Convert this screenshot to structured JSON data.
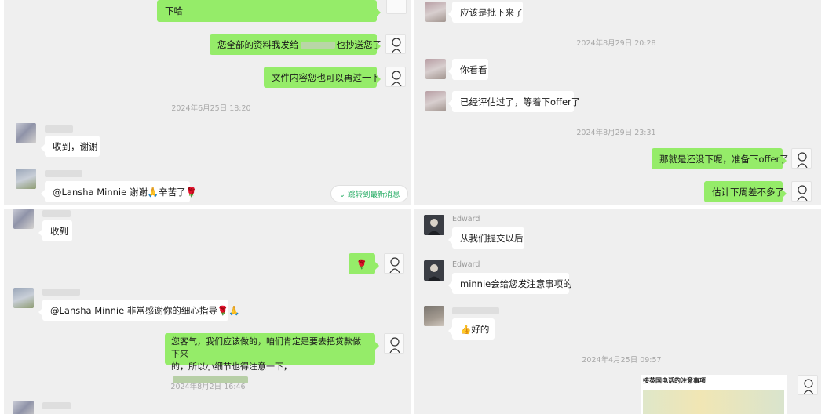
{
  "panel_tl": {
    "top_bubble": "下哈",
    "bubble_1": {
      "before": "您全部的资料我发给",
      "after": "也抄送您了"
    },
    "bubble_2": "文件内容您也可以再过一下",
    "timestamp": "2024年6月25日 18:20",
    "bubble_3": "收到，谢谢",
    "bubble_4": "@Lansha Minnie 谢谢🙏辛苦了🌹",
    "jump_button": "⌄ 跳转到最新消息"
  },
  "panel_tr": {
    "top_bubble": "应该是批下来了",
    "timestamp_1": "2024年8月29日 20:28",
    "bubble_1": "你看看",
    "bubble_2": "已经评估过了，等着下offer了",
    "timestamp_2": "2024年8月29日 23:31",
    "bubble_3": "那就是还没下呢，准备下offer了",
    "bubble_4": "估计下周差不多了"
  },
  "panel_bl": {
    "bubble_1": "收到",
    "bubble_2": "🌹",
    "bubble_3": "@Lansha Minnie 非常感谢你的细心指导🌹🙏",
    "bubble_4_line1": "您客气，我们应该做的，咱们肯定是要去把贷款做下来",
    "bubble_4_line2": "的，所以小细节也得注意一下，",
    "timestamp": "2024年8月2日 16:46"
  },
  "panel_br": {
    "sender_1": "Edward",
    "bubble_1": "从我们提交以后",
    "sender_2": "Edward",
    "bubble_2": "minnie会给您发注意事项的",
    "bubble_3": "👍好的",
    "timestamp": "2024年4月25日 09:57",
    "card_title": "接英国电话的注意事项"
  }
}
